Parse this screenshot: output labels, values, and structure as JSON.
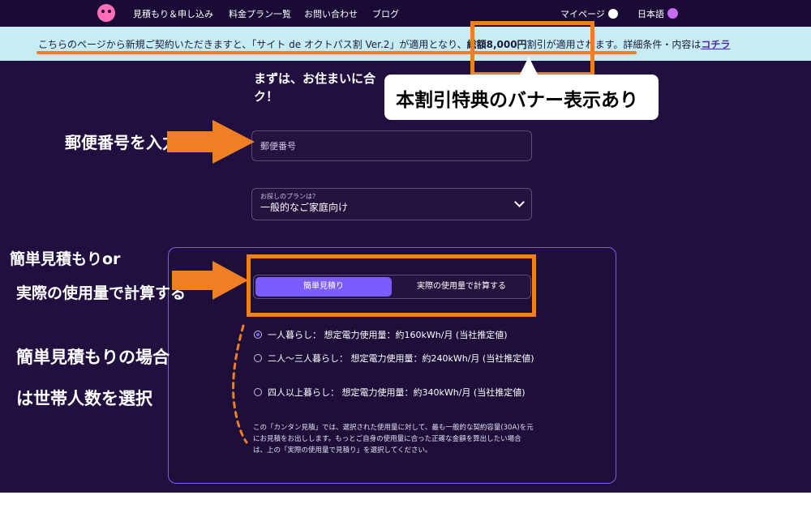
{
  "nav": {
    "items": [
      "見積もり＆申し込み",
      "料金プラン一覧",
      "お問い合わせ",
      "ブログ"
    ],
    "mypage": "マイページ",
    "language": "日本語"
  },
  "banner": {
    "text_before": "こちらのページから新規ご契約いただきますと、「サイト de オクトパス割 Ver.2」が適用となり、",
    "discount": "総額8,000円",
    "text_after": "割引が適用されます。詳細条件・内容は",
    "link": "コチラ"
  },
  "callout": "本割引特典のバナー表示あり",
  "form": {
    "heading": "まずは、お住まいに合ったプランをお選びください！",
    "heading_visible": "まずは、お住まいに合\nク！",
    "postal_placeholder": "郵便番号",
    "plan_label": "お探しのプランは？",
    "plan_value": "一般的なご家庭向け",
    "toggle_simple": "簡単見積り",
    "toggle_actual": "実際の使用量で計算する",
    "options": [
      "一人暮らし： 想定電力使用量：約160kWh/月 (当社推定値)",
      "二人〜三人暮らし： 想定電力使用量：約240kWh/月 (当社推定値)",
      "四人以上暮らし： 想定電力使用量：約340kWh/月 (当社推定値)"
    ],
    "note": "この「カンタン見積」では、選択された使用量に対して、最も一般的な契約容量(30A)を元にお見積をお出しします。もっとご自身の使用量に合った正確な金額を算出したい場合は、上の「実際の使用量で見積り」を選択してください。"
  },
  "annotations": {
    "postal": "郵便番号を入力",
    "toggle_line1": "簡単見積もりor",
    "toggle_line2": "実際の使用量で計算する",
    "simple_line1": "簡単見積もりの場合",
    "simple_line2": "は世帯人数を選択"
  },
  "colors": {
    "accent": "#f07e22",
    "primary": "#7b5cff",
    "background": "#21103f"
  }
}
